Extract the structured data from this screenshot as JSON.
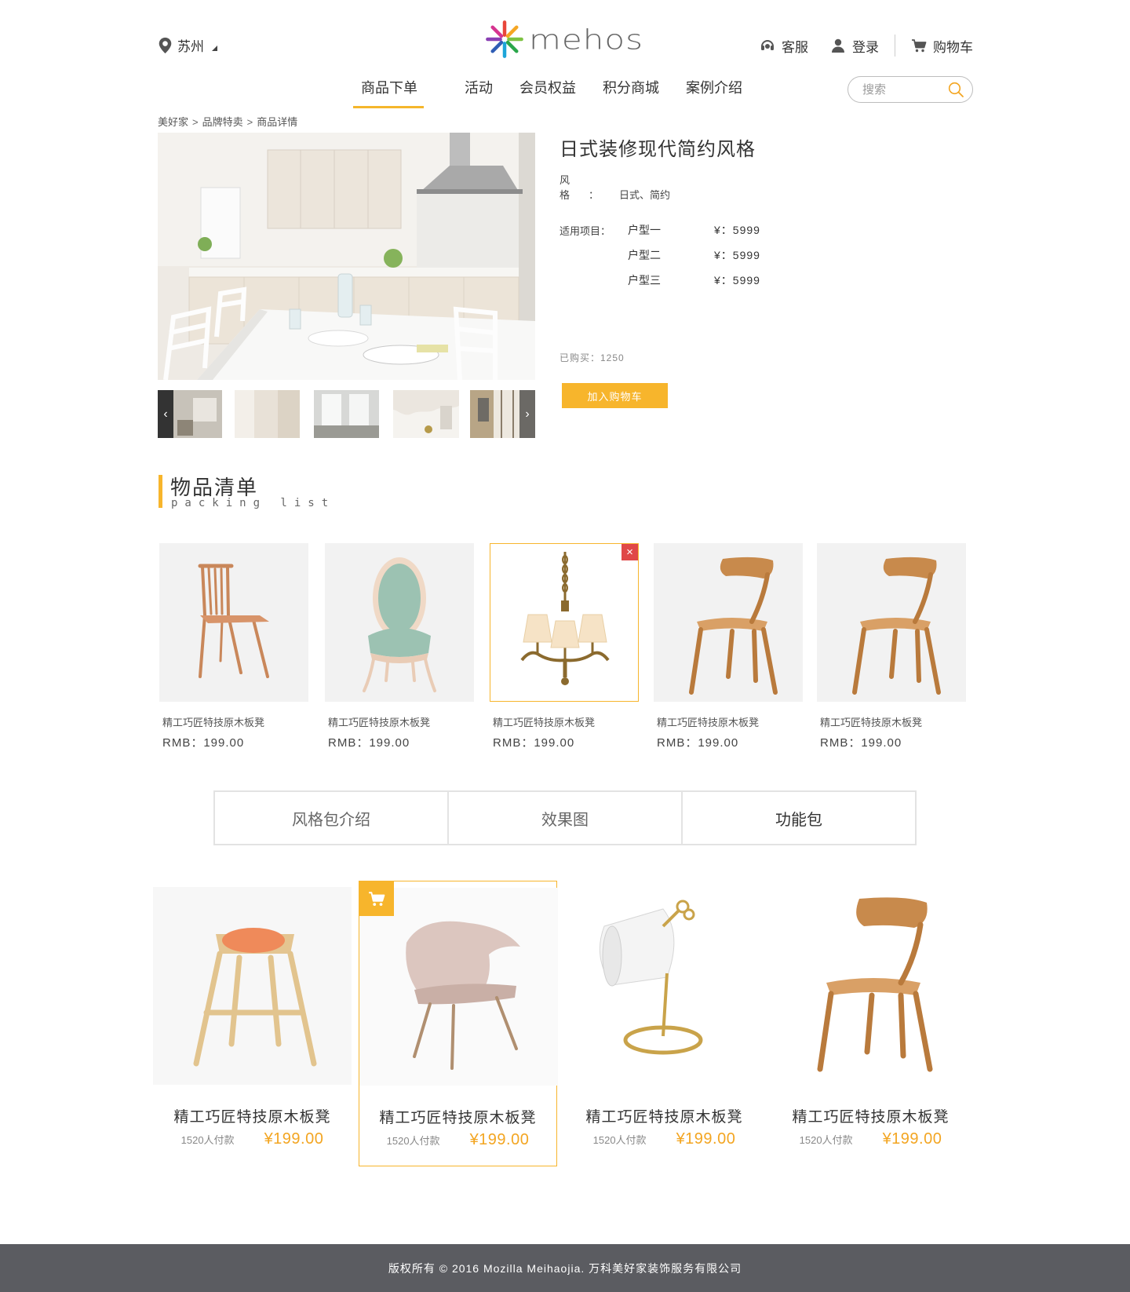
{
  "header": {
    "city": "苏州",
    "logo_text": "mehos",
    "service_label": "客服",
    "login_label": "登录",
    "cart_label": "购物车",
    "nav": [
      {
        "label": "商品下单",
        "active": true
      },
      {
        "label": "活动"
      },
      {
        "label": "会员权益"
      },
      {
        "label": "积分商城"
      },
      {
        "label": "案例介绍"
      }
    ],
    "search_placeholder": "搜索"
  },
  "breadcrumb": [
    "美好家",
    "品牌特卖",
    "商品详情"
  ],
  "breadcrumb_sep": ">",
  "product": {
    "title": "日式装修现代简约风格",
    "style_label": "风格：",
    "style_value": "日式、简约",
    "applicable_label": "适用项目：",
    "options": [
      {
        "type": "户型一",
        "price": "¥：5999"
      },
      {
        "type": "户型二",
        "price": "¥：5999"
      },
      {
        "type": "户型三",
        "price": "¥：5999"
      }
    ],
    "bought": "已购买：1250",
    "add_to_cart": "加入购物车",
    "prev_arrow": "‹",
    "next_arrow": "›"
  },
  "packing": {
    "title": "物品清单",
    "subtitle": "packing list",
    "items": [
      {
        "name": "精工巧匠特技原木板凳",
        "price": "RMB：199.00",
        "icon": "spindle-chair"
      },
      {
        "name": "精工巧匠特技原木板凳",
        "price": "RMB：199.00",
        "icon": "upholstered-chair"
      },
      {
        "name": "精工巧匠特技原木板凳",
        "price": "RMB：199.00",
        "icon": "chandelier",
        "selected": true
      },
      {
        "name": "精工巧匠特技原木板凳",
        "price": "RMB：199.00",
        "icon": "wood-chair"
      },
      {
        "name": "精工巧匠特技原木板凳",
        "price": "RMB：199.00",
        "icon": "wood-chair"
      }
    ],
    "remove_icon": "×"
  },
  "tabs": [
    {
      "label": "风格包介绍"
    },
    {
      "label": "效果图"
    },
    {
      "label": "功能包",
      "active": true
    }
  ],
  "grid": [
    {
      "name": "精工巧匠特技原木板凳",
      "sold": "1520人付款",
      "price": "¥199.00",
      "icon": "cushion-stool"
    },
    {
      "name": "精工巧匠特技原木板凳",
      "sold": "1520人付款",
      "price": "¥199.00",
      "icon": "lounge-chair",
      "selected": true
    },
    {
      "name": "精工巧匠特技原木板凳",
      "sold": "1520人付款",
      "price": "¥199.00",
      "icon": "desk-lamp"
    },
    {
      "name": "精工巧匠特技原木板凳",
      "sold": "1520人付款",
      "price": "¥199.00",
      "icon": "wood-chair"
    }
  ],
  "footer": "版权所有 © 2016 Mozilla Meihaojia. 万科美好家装饰服务有限公司",
  "colors": {
    "accent": "#f7b52c",
    "price": "#f3a521",
    "footer_bg": "#5b5c61",
    "remove": "#e04848"
  }
}
